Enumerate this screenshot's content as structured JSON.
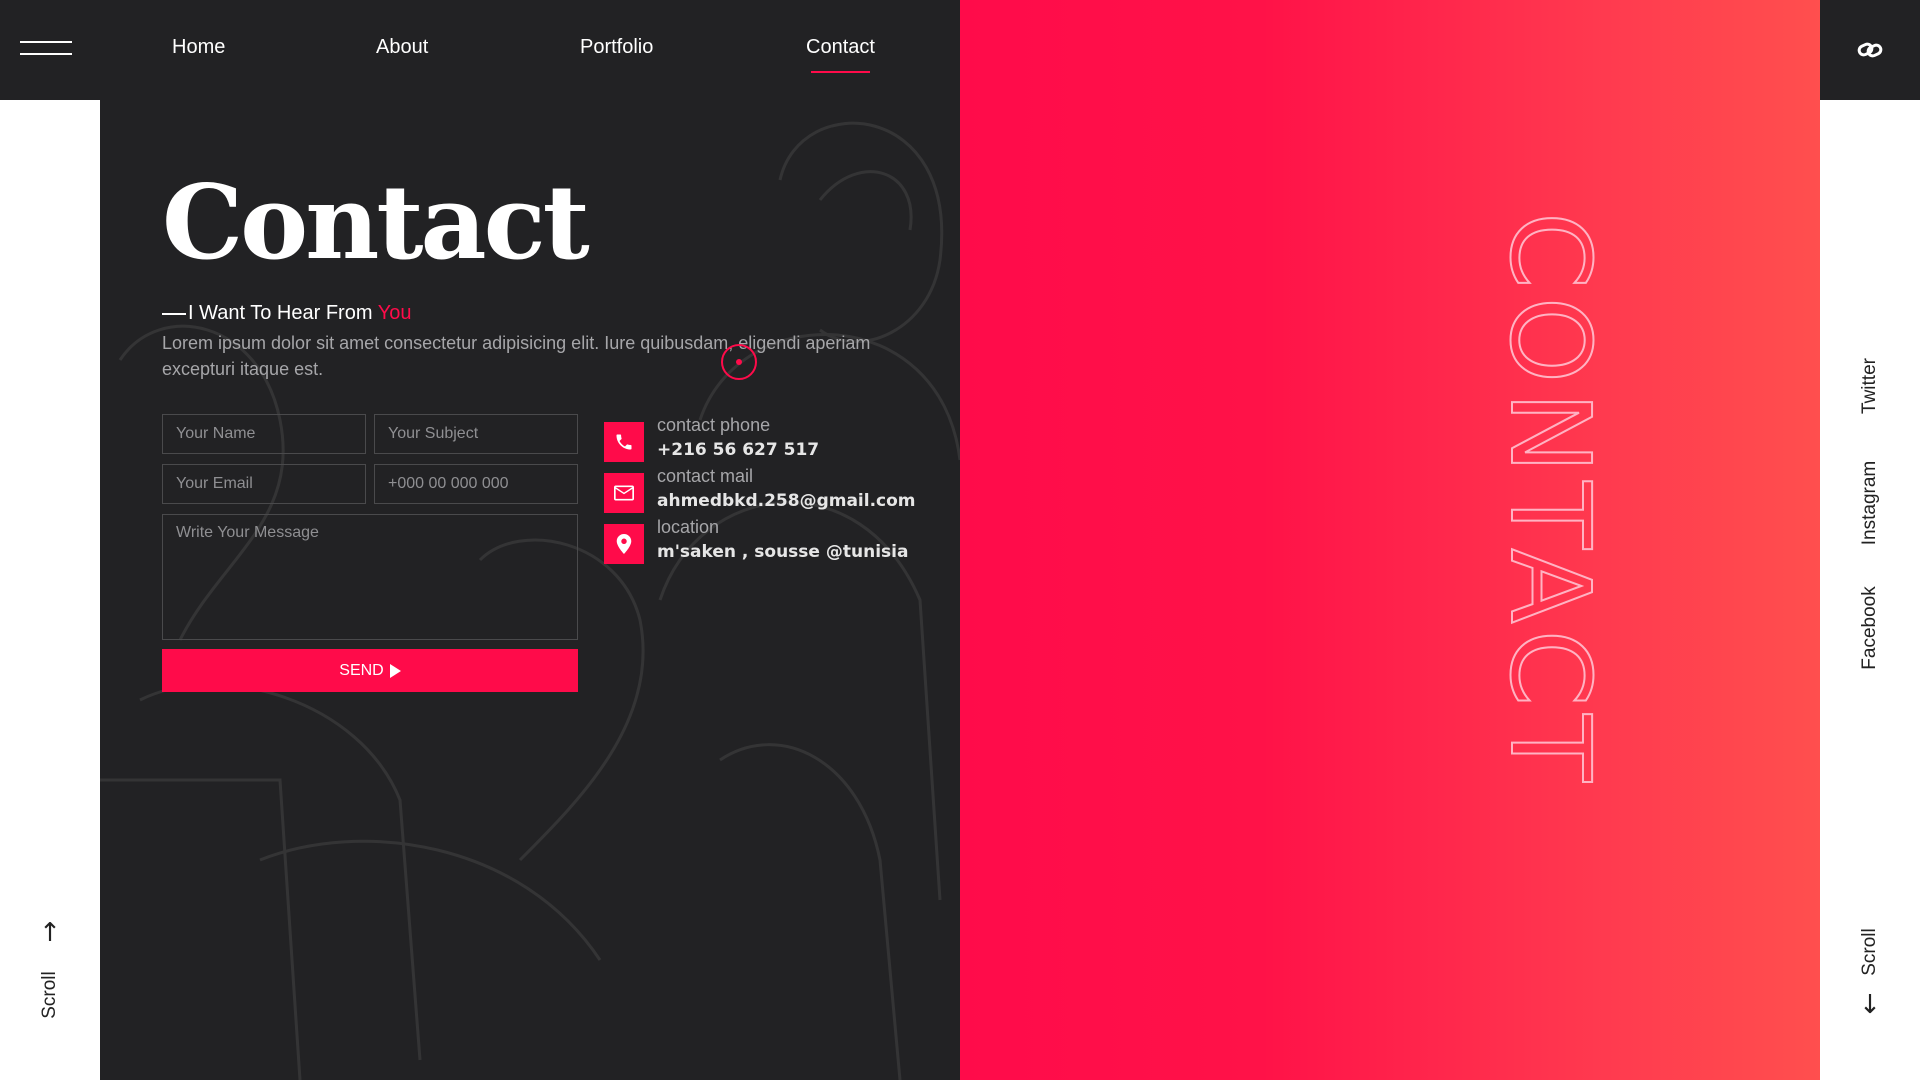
{
  "left_rail": {
    "scroll_label": "Scroll",
    "menu_icon": "hamburger-menu-icon",
    "arrow_icon": "arrow-up-icon"
  },
  "nav": {
    "items": [
      {
        "label": "Home"
      },
      {
        "label": "About"
      },
      {
        "label": "Portfolio"
      },
      {
        "label": "Contact",
        "active": true
      }
    ]
  },
  "hero": {
    "title": "Contact",
    "subtitle_prefix": "I Want To Hear From ",
    "subtitle_accent": "You",
    "lead": "Lorem ipsum dolor sit amet consectetur adipisicing elit. Iure quibusdam, eligendi aperiam excepturi itaque est."
  },
  "form": {
    "name_placeholder": "Your Name",
    "subject_placeholder": "Your Subject",
    "email_placeholder": "Your Email",
    "phone_placeholder": "+000 00 000 000",
    "message_placeholder": "Write Your Message",
    "send_label": "SEND"
  },
  "contact_info": {
    "phone_label": "contact phone",
    "phone_value": "+216 56 627 517",
    "mail_label": "contact mail",
    "mail_value": "ahmedbkd.258@gmail.com",
    "location_label": "location",
    "location_value": "m'saken , sousse @tunisia"
  },
  "side_word": "CONTACT",
  "right_rail": {
    "link_icon": "link-icon",
    "social": [
      {
        "label": "Twitter"
      },
      {
        "label": "Instagram"
      },
      {
        "label": "Facebook"
      }
    ],
    "scroll_label": "Scroll",
    "arrow_icon": "arrow-down-icon"
  },
  "colors": {
    "accent": "#ff0b4a",
    "dark": "#222224",
    "gradient_end": "#ff4f4e"
  }
}
